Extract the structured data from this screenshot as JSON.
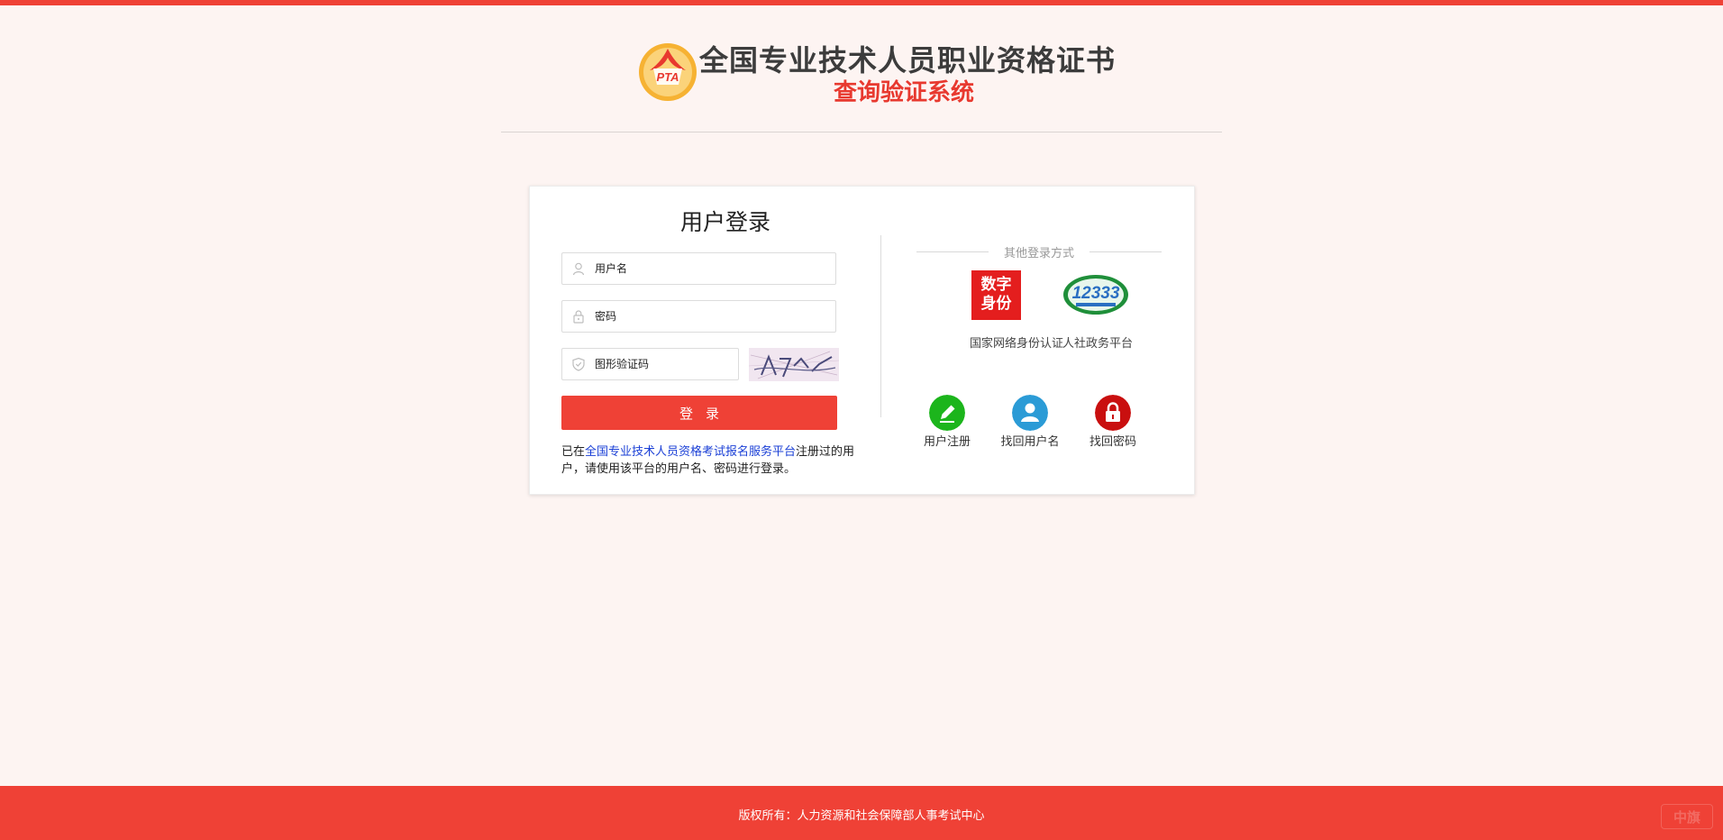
{
  "colors": {
    "brand_red": "#ef4136",
    "page_bg": "#fdf4f2",
    "link_blue": "#1a3fd6"
  },
  "header": {
    "logo_text": "PTA",
    "title": "全国专业技术人员职业资格证书",
    "subtitle": "查询验证系统"
  },
  "login": {
    "title": "用户登录",
    "username_placeholder": "用户名",
    "password_placeholder": "密码",
    "captcha_placeholder": "图形验证码",
    "captcha_text": "A7^ ✓",
    "submit_label": "登录",
    "notice_prefix": "已在",
    "notice_link": "全国专业技术人员资格考试报名服务平台",
    "notice_suffix": "注册过的用户，请使用该平台的用户名、密码进行登录。"
  },
  "other_login": {
    "title": "其他登录方式",
    "providers": [
      {
        "label": "国家网络身份认证",
        "icon": "digital-identity-icon",
        "icon_text_1": "数字",
        "icon_text_2": "身份"
      },
      {
        "label": "人社政务平台",
        "icon": "12333-icon",
        "icon_text": "12333"
      }
    ]
  },
  "quick_links": [
    {
      "label": "用户注册",
      "icon": "pencil-icon",
      "color": "#1cb51c"
    },
    {
      "label": "找回用户名",
      "icon": "user-icon",
      "color": "#2b9bd6"
    },
    {
      "label": "找回密码",
      "icon": "lock-icon",
      "color": "#c90f0f"
    }
  ],
  "footer": {
    "copyright": "版权所有：人力资源和社会保障部人事考试中心",
    "badge": "中旗"
  }
}
